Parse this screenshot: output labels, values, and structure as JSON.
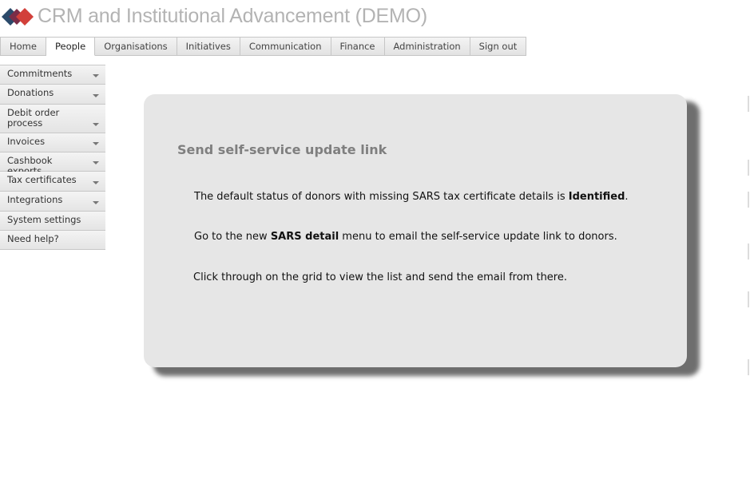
{
  "header": {
    "title": "CRM and Institutional Advancement (DEMO)",
    "logo": "diamond-logo"
  },
  "topnav": {
    "tabs": [
      {
        "label": "Home"
      },
      {
        "label": "People"
      },
      {
        "label": "Organisations"
      },
      {
        "label": "Initiatives"
      },
      {
        "label": "Communication"
      },
      {
        "label": "Finance"
      },
      {
        "label": "Administration"
      },
      {
        "label": "Sign out"
      }
    ],
    "active": "People"
  },
  "sidebar": {
    "items": [
      {
        "label": "Commitments",
        "icon": "chevron-down-icon"
      },
      {
        "label": "Donations",
        "icon": "chevron-down-icon"
      },
      {
        "label": "Debit order process",
        "icon": "chevron-down-icon"
      },
      {
        "label": "Invoices",
        "icon": "chevron-down-icon"
      },
      {
        "label": "Cashbook exports",
        "icon": "chevron-down-icon"
      },
      {
        "label": "Tax certificates",
        "icon": "chevron-down-icon"
      },
      {
        "label": "Integrations",
        "icon": "chevron-down-icon"
      },
      {
        "label": "System settings"
      },
      {
        "label": "Need help?"
      }
    ]
  },
  "panel": {
    "title": "Send self-service update link",
    "line1_pre": "The default status of donors with missing SARS tax certificate details is ",
    "line1_bold": "Identified",
    "line1_post": ".",
    "line2_pre": "Go to the new ",
    "line2_bold": "SARS detail",
    "line2_post": " menu to email the self-service update link to donors.",
    "line3": "Click through on the grid to view the list and send the email from there."
  },
  "colors": {
    "title_gray": "#b3b3b3",
    "panel_bg": "#e6e6e6",
    "logo_dark": "#2b4a6a",
    "logo_red": "#c0392b"
  }
}
